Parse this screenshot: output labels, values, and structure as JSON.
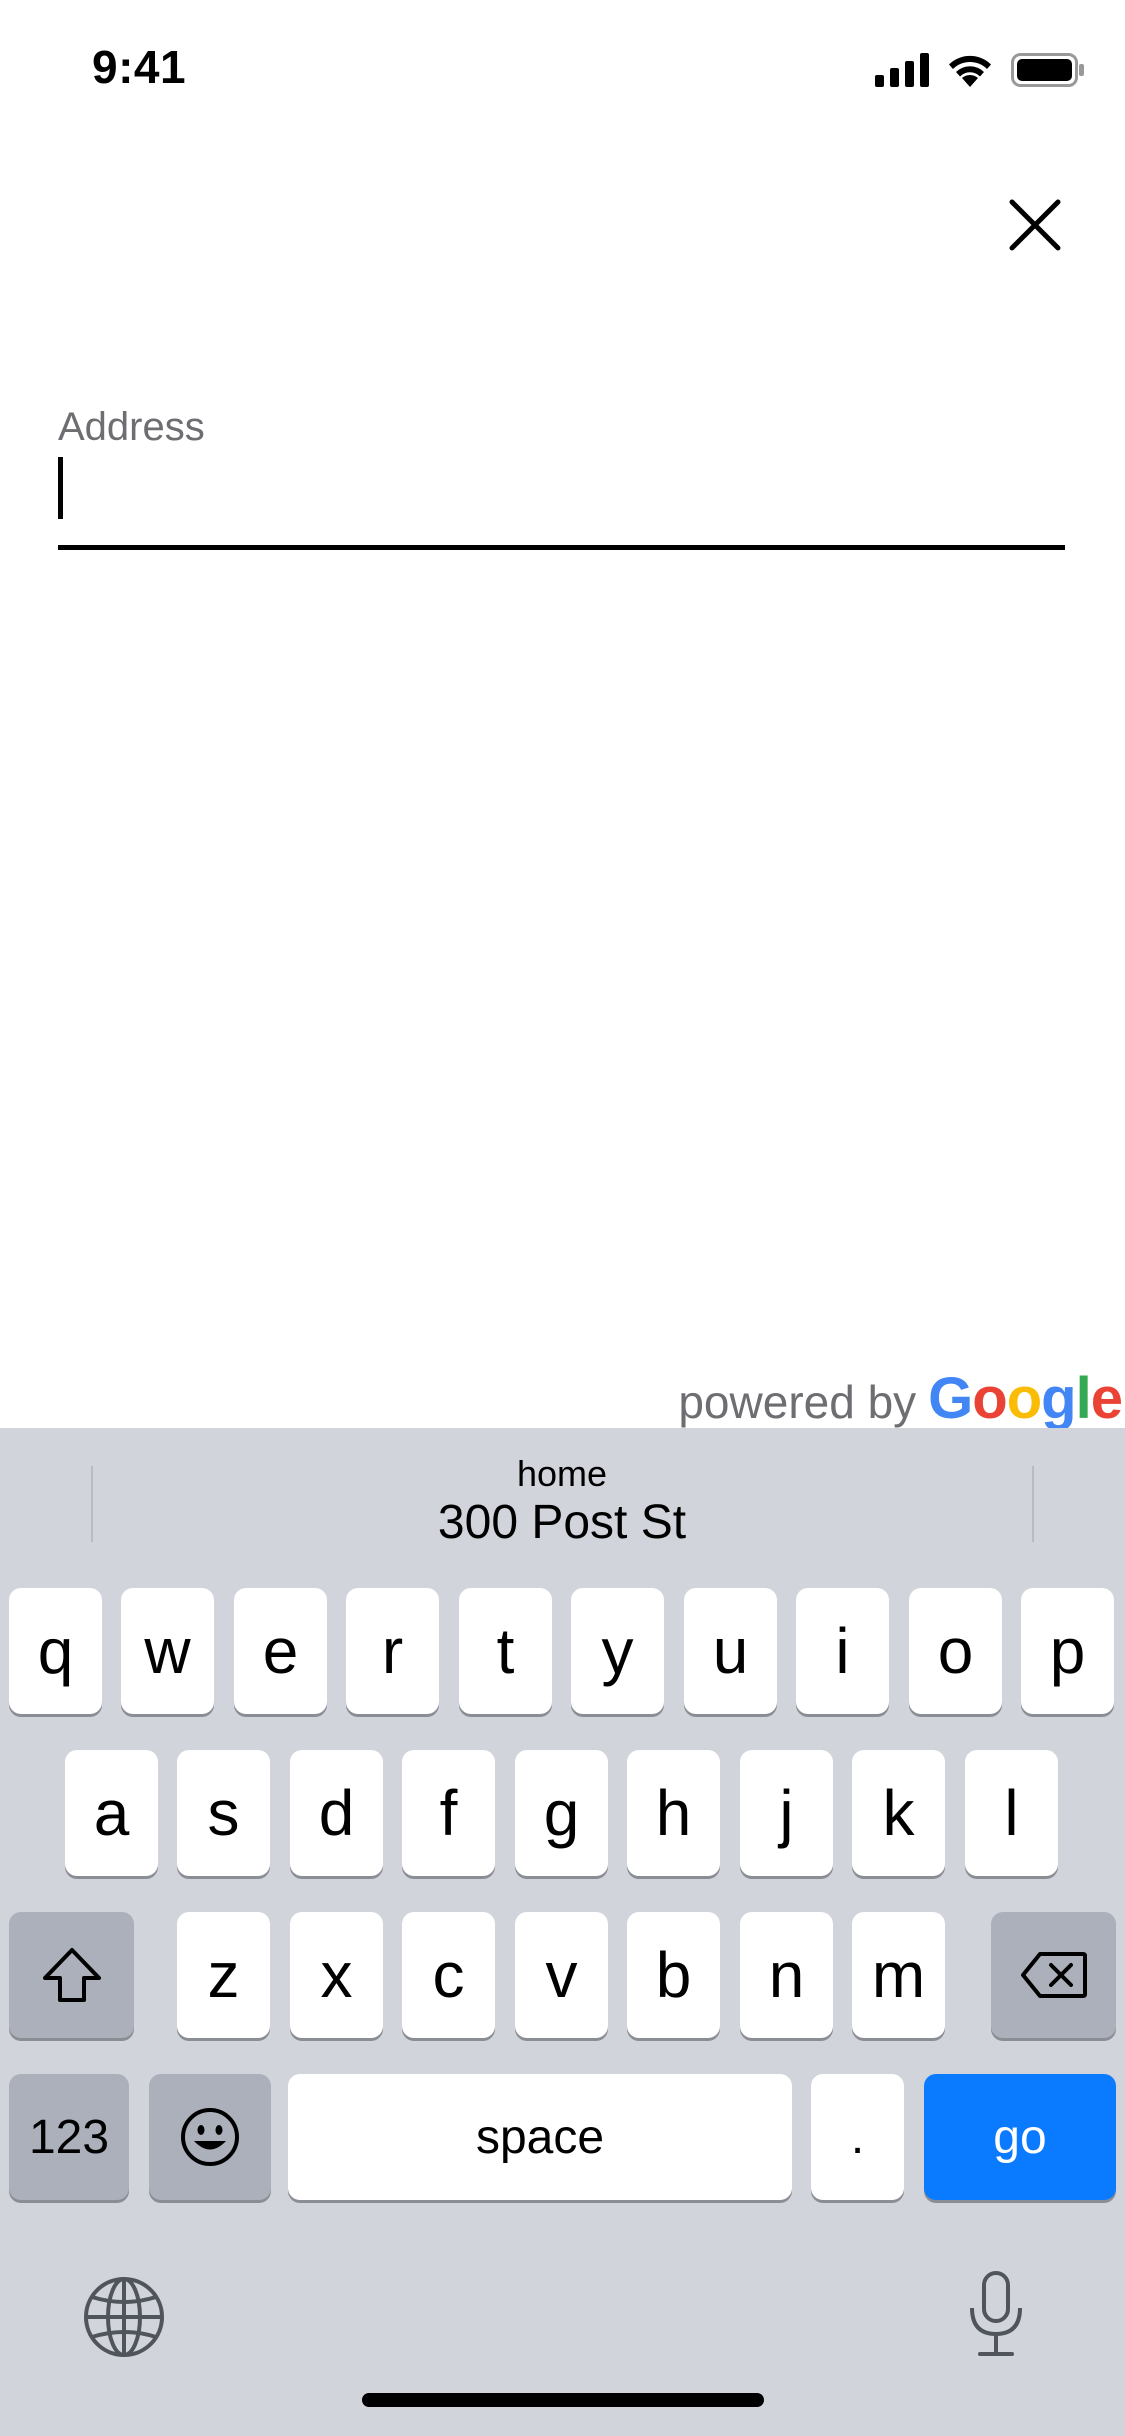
{
  "status_bar": {
    "time": "9:41"
  },
  "address": {
    "label": "Address",
    "value": "",
    "placeholder": ""
  },
  "attribution": {
    "powered_by": "powered by",
    "google": {
      "letters": [
        "G",
        "o",
        "o",
        "g",
        "l",
        "e"
      ],
      "colors": [
        "#4285F4",
        "#EA4335",
        "#FBBC05",
        "#4285F4",
        "#34A853",
        "#EA4335"
      ]
    }
  },
  "keyboard": {
    "suggestion": {
      "sub": "home",
      "main": "300 Post St"
    },
    "row1": [
      "q",
      "w",
      "e",
      "r",
      "t",
      "y",
      "u",
      "i",
      "o",
      "p"
    ],
    "row2": [
      "a",
      "s",
      "d",
      "f",
      "g",
      "h",
      "j",
      "k",
      "l"
    ],
    "row3": [
      "z",
      "x",
      "c",
      "v",
      "b",
      "n",
      "m"
    ],
    "numbers_label": "123",
    "space_label": "space",
    "period_label": ".",
    "go_label": "go",
    "go_color": "#0A7AFF",
    "background_color": "#D1D4DB"
  }
}
